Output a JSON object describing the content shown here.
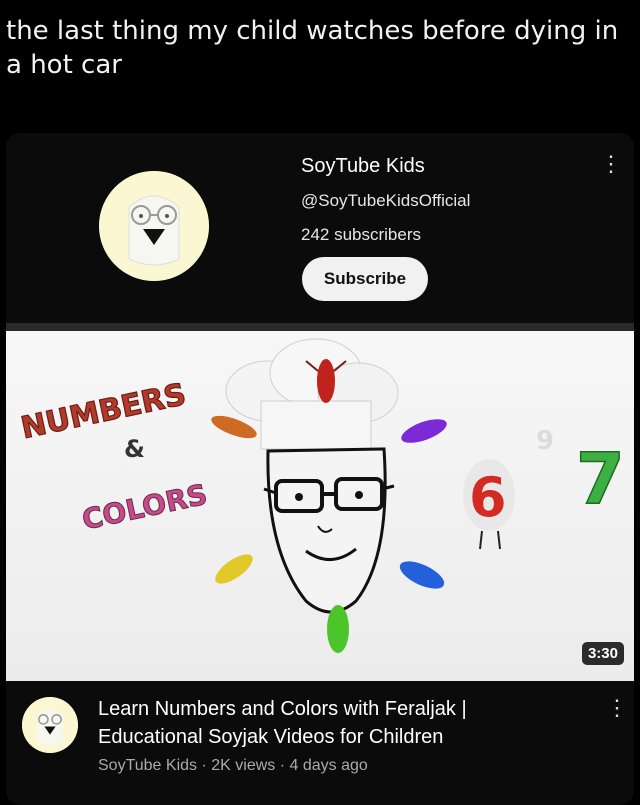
{
  "caption": "the last thing my child watches before dying in a hot car",
  "channel": {
    "name": "SoyTube Kids",
    "handle": "@SoyTubeKidsOfficial",
    "subscribers": "242 subscribers",
    "subscribe_label": "Subscribe"
  },
  "thumbnail": {
    "title_line1": "NUMBERS",
    "ampersand": "&",
    "title_line2": "COLORS",
    "digit_red": "6",
    "digit_green": "7",
    "digit_faint": "9",
    "duration": "3:30"
  },
  "video": {
    "title": "Learn Numbers and Colors with Feraljak | Educational Soyjak Videos for Children",
    "channel": "SoyTube Kids",
    "views": "2K views",
    "age": "4 days ago",
    "separator": "·"
  },
  "icons": {
    "menu": "more-vert-icon"
  },
  "colors": {
    "background": "#000000",
    "card": "#0b0b0b",
    "subscribe_bg": "#f1f1f1",
    "meta_text": "#aaaaaa"
  }
}
